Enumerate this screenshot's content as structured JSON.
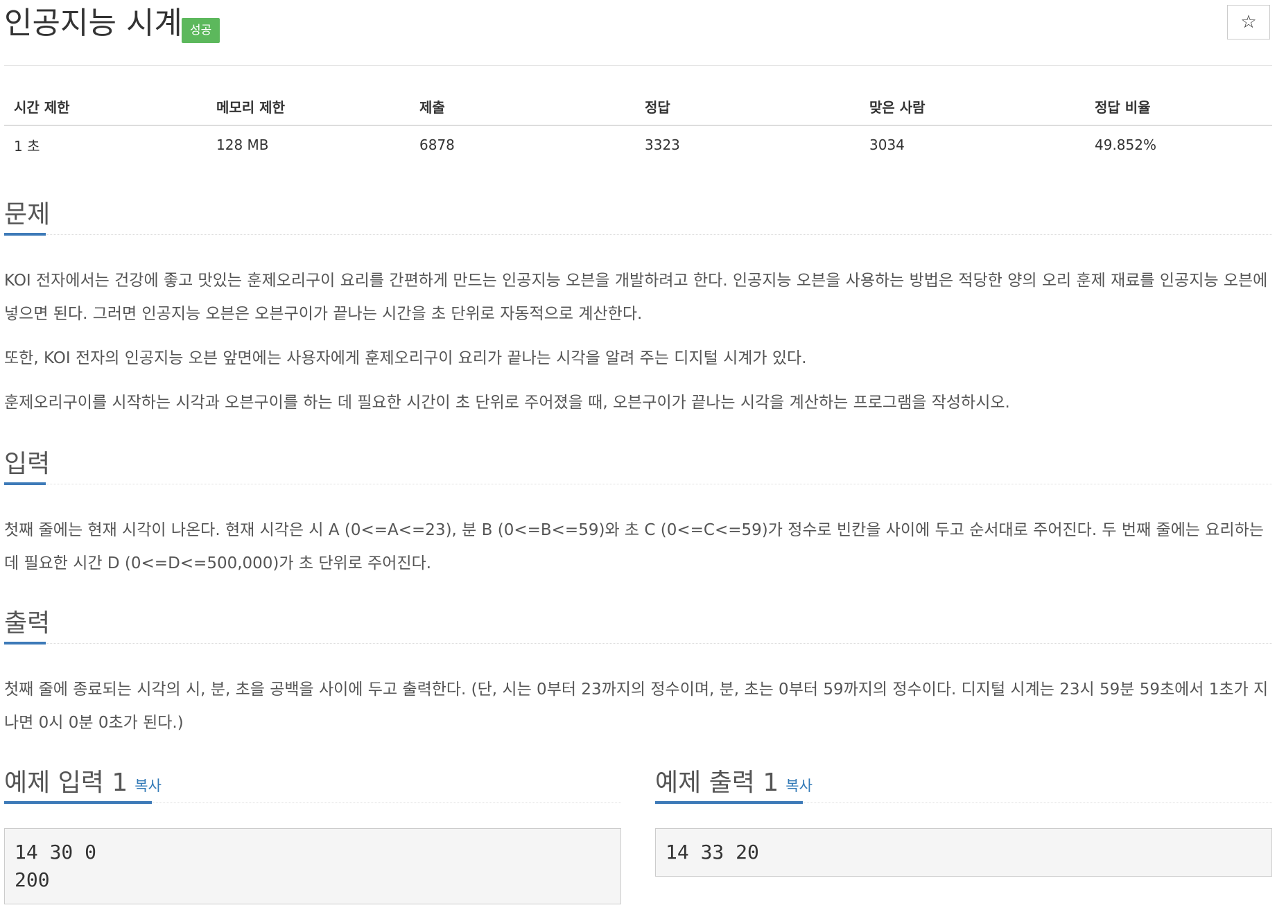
{
  "header": {
    "title": "인공지능 시계",
    "badge": "성공",
    "star_label": "☆"
  },
  "info": {
    "headers": [
      "시간 제한",
      "메모리 제한",
      "제출",
      "정답",
      "맞은 사람",
      "정답 비율"
    ],
    "values": [
      "1 초",
      "128 MB",
      "6878",
      "3323",
      "3034",
      "49.852%"
    ]
  },
  "problem": {
    "title": "문제",
    "p1": "KOI 전자에서는 건강에 좋고 맛있는 훈제오리구이 요리를 간편하게 만드는 인공지능 오븐을 개발하려고 한다. 인공지능 오븐을 사용하는 방법은 적당한 양의 오리 훈제 재료를 인공지능 오븐에 넣으면 된다. 그러면 인공지능 오븐은 오븐구이가 끝나는 시간을 초 단위로 자동적으로 계산한다.",
    "p2": "또한, KOI 전자의 인공지능 오븐 앞면에는 사용자에게 훈제오리구이 요리가 끝나는 시각을 알려 주는 디지털 시계가 있다.",
    "p3": "훈제오리구이를 시작하는 시각과 오븐구이를 하는 데 필요한 시간이 초 단위로 주어졌을 때, 오븐구이가 끝나는 시각을 계산하는 프로그램을 작성하시오."
  },
  "input": {
    "title": "입력",
    "p1": "첫째 줄에는 현재 시각이 나온다. 현재 시각은 시 A (0<=A<=23), 분 B (0<=B<=59)와 초 C (0<=C<=59)가 정수로 빈칸을 사이에 두고 순서대로 주어진다. 두 번째 줄에는 요리하는 데 필요한 시간 D (0<=D<=500,000)가 초 단위로 주어진다."
  },
  "output": {
    "title": "출력",
    "p1": "첫째 줄에 종료되는 시각의 시, 분, 초을 공백을 사이에 두고 출력한다. (단, 시는 0부터 23까지의 정수이며, 분, 초는 0부터 59까지의 정수이다. 디지털 시계는 23시 59분 59초에서 1초가 지나면 0시 0분 0초가 된다.)"
  },
  "sample_input": {
    "title": "예제 입력 1",
    "copy": "복사",
    "content": "14 30 0\n200"
  },
  "sample_output": {
    "title": "예제 출력 1",
    "copy": "복사",
    "content": "14 33 20"
  }
}
